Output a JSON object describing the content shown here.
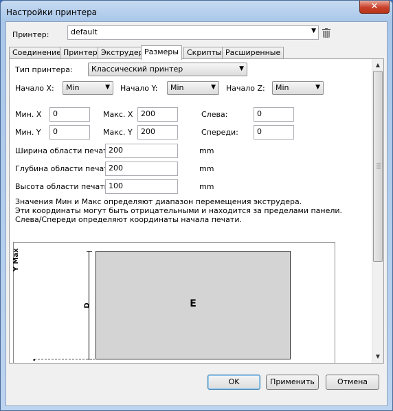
{
  "window": {
    "title": "Настройки принтера",
    "close_glyph": "✕"
  },
  "printer": {
    "label": "Принтер:",
    "value": "default"
  },
  "tabs": [
    {
      "label": "Соединение"
    },
    {
      "label": "Принтер"
    },
    {
      "label": "Экструдер"
    },
    {
      "label": "Размеры",
      "active": true
    },
    {
      "label": "Скрипты"
    },
    {
      "label": "Расширенные"
    }
  ],
  "dimensions": {
    "printer_type_label": "Тип принтера:",
    "printer_type_value": "Классический принтер",
    "start_x_label": "Начало X:",
    "start_x_value": "Min",
    "start_y_label": "Начало Y:",
    "start_y_value": "Min",
    "start_z_label": "Начало Z:",
    "start_z_value": "Min",
    "min_x_label": "Мин. X",
    "min_x_value": "0",
    "max_x_label": "Макс. X",
    "max_x_value": "200",
    "left_label": "Слева:",
    "left_value": "0",
    "min_y_label": "Мин. Y",
    "min_y_value": "0",
    "max_y_label": "Макс. Y",
    "max_y_value": "200",
    "front_label": "Спереди:",
    "front_value": "0",
    "print_width_label": "Ширина области печати:",
    "print_width_value": "200",
    "print_width_unit": "mm",
    "print_depth_label": "Глубина области печати:",
    "print_depth_value": "200",
    "print_depth_unit": "mm",
    "print_height_label": "Высота области печати:",
    "print_height_value": "100",
    "print_height_unit": "mm",
    "info_line1": "Значения Мин и Макс определяют диапазон перемещения экструдера.",
    "info_line2": "Эти координаты могут быть отрицательными и находится за пределами панели.",
    "info_line3": "Слева/Спереди определяют координаты начала печати."
  },
  "diagram": {
    "y_max_label": "Y Max",
    "bed_letter": "E",
    "depth_letter": "D"
  },
  "buttons": {
    "ok": "OK",
    "apply": "Применить",
    "cancel": "Отмена"
  },
  "icons": {
    "dropdown": "chevron-down-icon",
    "delete": "trash-icon",
    "scroll_up": "scroll-up-arrow",
    "scroll_down": "scroll-down-arrow"
  }
}
